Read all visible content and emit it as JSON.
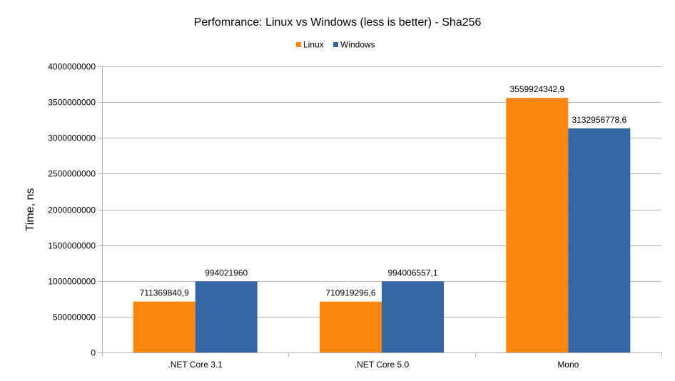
{
  "chart_data": {
    "type": "bar",
    "title": "Perfomrance: Linux vs Windows (less is better) - Sha256",
    "xlabel": "",
    "ylabel": "Time, ns",
    "categories": [
      ".NET Core 3.1",
      ".NET Core 5.0",
      "Mono"
    ],
    "series": [
      {
        "name": "Linux",
        "color": "#FF860D",
        "values": [
          711369840.9,
          710919296.6,
          3559924342.9
        ],
        "labels": [
          "711369840,9",
          "710919296,6",
          "3559924342,9"
        ]
      },
      {
        "name": "Windows",
        "color": "#3465A4",
        "values": [
          994021960,
          994006557.1,
          3132956778.6
        ],
        "labels": [
          "994021960",
          "994006557,1",
          "3132956778,6"
        ]
      }
    ],
    "ylim": [
      0,
      4000000000
    ],
    "yticks": [
      0,
      500000000,
      1000000000,
      1500000000,
      2000000000,
      2500000000,
      3000000000,
      3500000000,
      4000000000
    ],
    "ytick_labels": [
      "0",
      "500000000",
      "1000000000",
      "1500000000",
      "2000000000",
      "2500000000",
      "3000000000",
      "3500000000",
      "4000000000"
    ],
    "grid": true,
    "legend_position": "top-center"
  }
}
